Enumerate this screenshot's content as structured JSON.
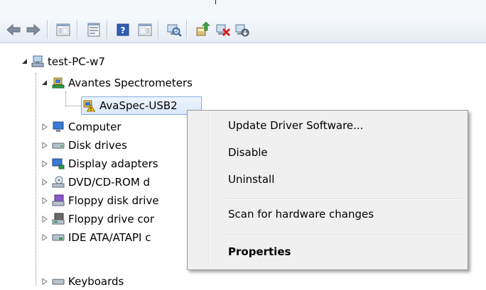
{
  "toolbar": {
    "buttons": [
      {
        "icon": "back-arrow-icon"
      },
      {
        "icon": "forward-arrow-icon"
      },
      {
        "icon": "show-hide-console-tree-icon"
      },
      {
        "icon": "properties-icon"
      },
      {
        "icon": "help-icon"
      },
      {
        "icon": "show-action-pane-icon"
      },
      {
        "icon": "scan-hardware-changes-icon"
      },
      {
        "icon": "update-driver-icon"
      },
      {
        "icon": "uninstall-icon"
      },
      {
        "icon": "disable-device-icon"
      }
    ]
  },
  "tree": {
    "root": {
      "label": "test-PC-w7",
      "icon": "computer-network-icon",
      "expanded": true
    },
    "items": [
      {
        "label": "Avantes Spectrometers",
        "icon": "spectrometer-category-icon",
        "expanded": true
      },
      {
        "label": "AvaSpec-USB2",
        "icon": "device-warning-icon",
        "selected": true
      },
      {
        "label": "Computer",
        "icon": "computer-icon",
        "expanded": false
      },
      {
        "label": "Disk drives",
        "icon": "disk-drive-icon",
        "expanded": false
      },
      {
        "label": "Display adapters",
        "icon": "display-adapter-icon",
        "expanded": false
      },
      {
        "label": "DVD/CD-ROM d",
        "icon": "dvd-drive-icon",
        "expanded": false
      },
      {
        "label": "Floppy disk drive",
        "icon": "floppy-disk-icon",
        "expanded": false
      },
      {
        "label": "Floppy drive cor",
        "icon": "floppy-controller-icon",
        "expanded": false
      },
      {
        "label": "IDE ATA/ATAPI c",
        "icon": "ide-controller-icon",
        "expanded": false
      },
      {
        "label": "Keyboards",
        "icon": "keyboard-icon",
        "expanded": false
      }
    ]
  },
  "context_menu": {
    "items": [
      {
        "label": "Update Driver Software...",
        "bold": false
      },
      {
        "label": "Disable",
        "bold": false
      },
      {
        "label": "Uninstall",
        "bold": false
      },
      {
        "separator": true
      },
      {
        "label": "Scan for hardware changes",
        "bold": false
      },
      {
        "separator": true
      },
      {
        "label": "Properties",
        "bold": true
      }
    ]
  },
  "colors": {
    "selection_border": "#84acdd",
    "menu_background": "#f0f0f0",
    "warning": "#f5c400"
  }
}
